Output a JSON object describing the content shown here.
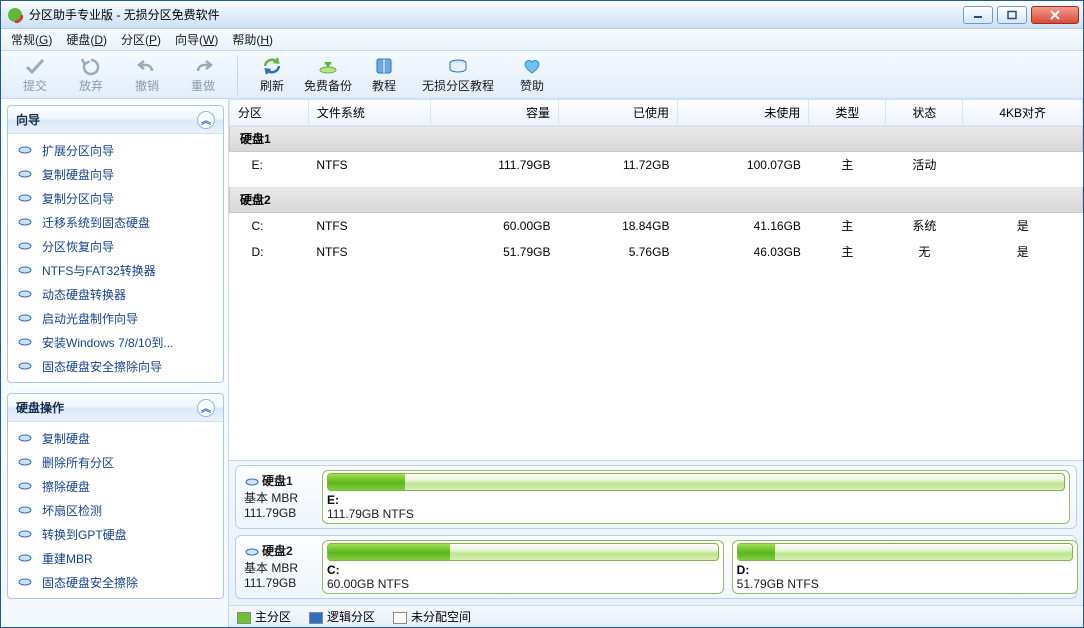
{
  "window": {
    "title": "分区助手专业版 - 无损分区免费软件"
  },
  "menu": [
    "常规(G)",
    "硬盘(D)",
    "分区(P)",
    "向导(W)",
    "帮助(H)"
  ],
  "toolbar": [
    {
      "id": "commit",
      "label": "提交",
      "icon": "check"
    },
    {
      "id": "discard",
      "label": "放弃",
      "icon": "revert"
    },
    {
      "id": "undo",
      "label": "撤销",
      "icon": "undo"
    },
    {
      "id": "redo",
      "label": "重做",
      "icon": "redo"
    },
    {
      "sep": true
    },
    {
      "id": "refresh",
      "label": "刷新",
      "icon": "refresh"
    },
    {
      "id": "backup",
      "label": "免费备份",
      "icon": "backup"
    },
    {
      "id": "tutor",
      "label": "教程",
      "icon": "book"
    },
    {
      "id": "lossless",
      "label": "无损分区教程",
      "icon": "disk"
    },
    {
      "id": "donate",
      "label": "赞助",
      "icon": "heart"
    }
  ],
  "sidebar": {
    "sections": [
      {
        "title": "向导",
        "items": [
          {
            "label": "扩展分区向导",
            "icon": "expand"
          },
          {
            "label": "复制硬盘向导",
            "icon": "copy-disk"
          },
          {
            "label": "复制分区向导",
            "icon": "copy-part"
          },
          {
            "label": "迁移系统到固态硬盘",
            "icon": "migrate"
          },
          {
            "label": "分区恢复向导",
            "icon": "recover"
          },
          {
            "label": "NTFS与FAT32转换器",
            "icon": "convert"
          },
          {
            "label": "动态硬盘转换器",
            "icon": "dynamic"
          },
          {
            "label": "启动光盘制作向导",
            "icon": "media"
          },
          {
            "label": "安装Windows 7/8/10到...",
            "icon": "win"
          },
          {
            "label": "固态硬盘安全擦除向导",
            "icon": "erase"
          }
        ]
      },
      {
        "title": "硬盘操作",
        "items": [
          {
            "label": "复制硬盘",
            "icon": "copy-disk"
          },
          {
            "label": "删除所有分区",
            "icon": "delete"
          },
          {
            "label": "擦除硬盘",
            "icon": "wipe"
          },
          {
            "label": "坏扇区检测",
            "icon": "badsec"
          },
          {
            "label": "转换到GPT硬盘",
            "icon": "gpt"
          },
          {
            "label": "重建MBR",
            "icon": "mbr"
          },
          {
            "label": "固态硬盘安全擦除",
            "icon": "erase"
          }
        ]
      }
    ]
  },
  "columns": [
    "分区",
    "文件系统",
    "容量",
    "已使用",
    "未使用",
    "类型",
    "状态",
    "4KB对齐"
  ],
  "groups": [
    {
      "name": "硬盘1",
      "rows": [
        {
          "part": "E:",
          "fs": "NTFS",
          "cap": "111.79GB",
          "used": "11.72GB",
          "free": "100.07GB",
          "type": "主",
          "status": "活动",
          "align": ""
        }
      ]
    },
    {
      "name": "硬盘2",
      "rows": [
        {
          "part": "C:",
          "fs": "NTFS",
          "cap": "60.00GB",
          "used": "18.84GB",
          "free": "41.16GB",
          "type": "主",
          "status": "系统",
          "align": "是"
        },
        {
          "part": "D:",
          "fs": "NTFS",
          "cap": "51.79GB",
          "used": "5.76GB",
          "free": "46.03GB",
          "type": "主",
          "status": "无",
          "align": "是"
        }
      ]
    }
  ],
  "disks": [
    {
      "name": "硬盘1",
      "scheme": "基本 MBR",
      "size": "111.79GB",
      "parts": [
        {
          "letter": "E:",
          "desc": "111.79GB NTFS",
          "usedPct": 10.5,
          "widthPct": 100
        }
      ]
    },
    {
      "name": "硬盘2",
      "scheme": "基本 MBR",
      "size": "111.79GB",
      "parts": [
        {
          "letter": "C:",
          "desc": "60.00GB NTFS",
          "usedPct": 31.4,
          "widthPct": 53.7
        },
        {
          "letter": "D:",
          "desc": "51.79GB NTFS",
          "usedPct": 11.1,
          "widthPct": 46.3
        }
      ]
    }
  ],
  "legend": {
    "primary": "主分区",
    "logical": "逻辑分区",
    "unalloc": "未分配空间"
  }
}
